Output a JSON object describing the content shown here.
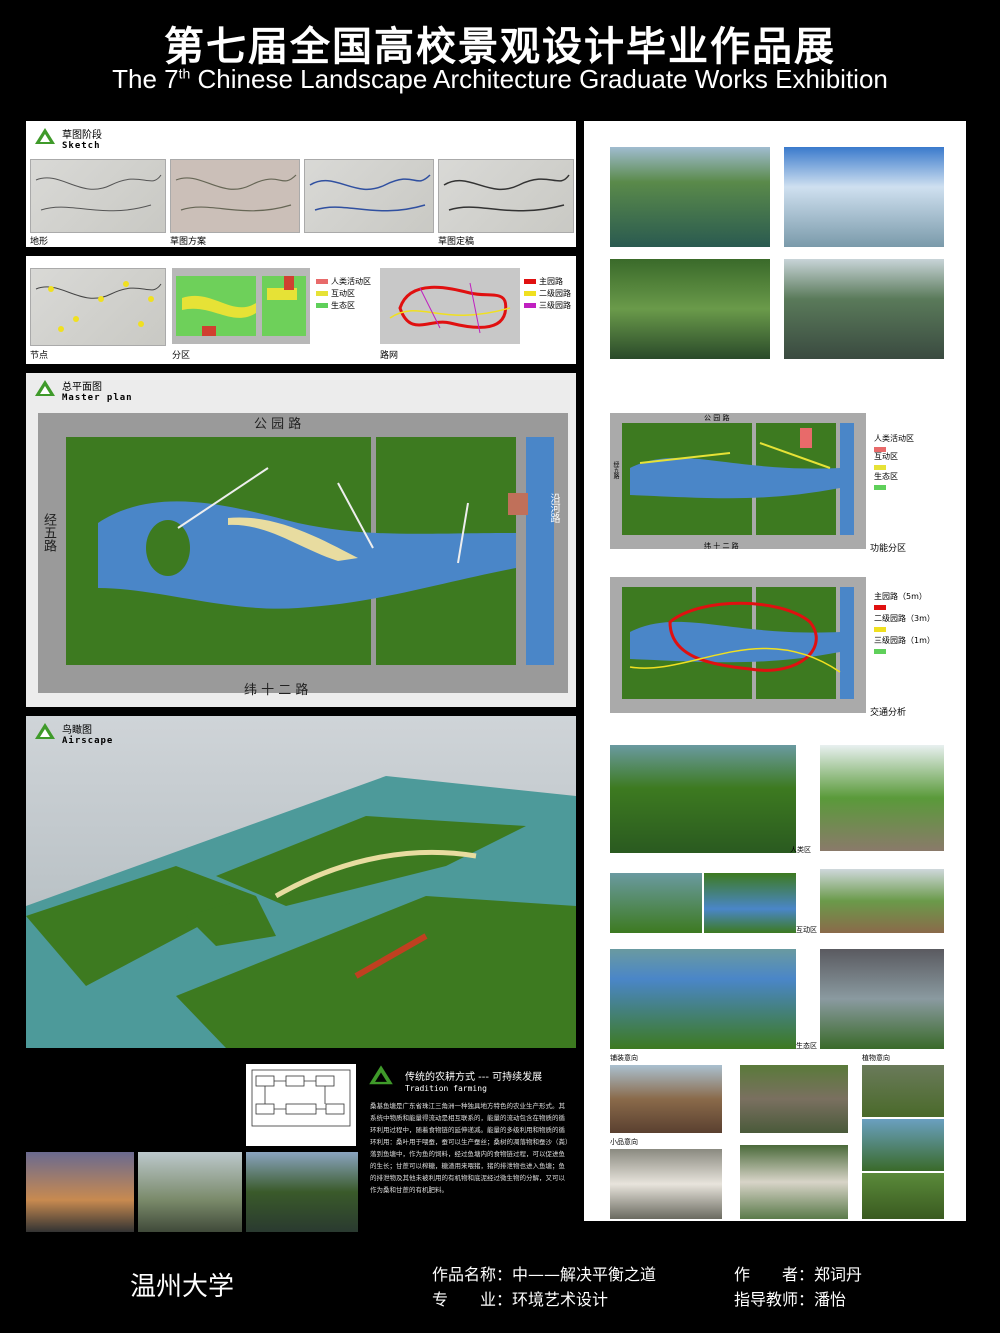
{
  "title_cn": "第七届全国高校景观设计毕业作品展",
  "title_en_pre": "The 7",
  "title_en_sup": "th",
  "title_en_post": " Chinese Landscape Architecture Graduate Works Exhibition",
  "sketch": {
    "heading_cn": "草图阶段",
    "heading_en": "Sketch",
    "captions": [
      "地形",
      "草图方案",
      "草图定稿"
    ]
  },
  "analysis": {
    "captions": [
      "节点",
      "分区",
      "路网"
    ],
    "zone_legend": [
      "人类活动区",
      "互动区",
      "生态区"
    ],
    "road_legend": [
      "主园路",
      "二级园路",
      "三级园路"
    ]
  },
  "master_plan": {
    "heading_cn": "总平面图",
    "heading_en": "Master plan",
    "road_top": "公 园 路",
    "road_bottom": "纬 十 二 路",
    "road_left": "经五路",
    "road_right": "沿河路"
  },
  "airscape": {
    "heading_cn": "鸟瞰图",
    "heading_en": "Airscape"
  },
  "tradition": {
    "heading_cn": "传统的农耕方式 --- 可持续发展",
    "heading_en": "Tradition farming",
    "paragraph": "桑基鱼塘是广东省珠江三角洲一种独具地方特色的农业生产形式。其系统中物质和能量得流动是相互联系的，能量的流动包含在物质的循环利用过程中，随着食物链的延伸递减。能量的多级利用和物质的循环利用：桑叶用于喂蚕，蚕可以生产蚕丝；桑树的凋落物和蚕沙（粪）落到鱼塘中，作为鱼的饲料，经过鱼塘内的食物链过程，可以促进鱼的生长；甘蔗可以榨糖，糖渣用来喂猪，猪的排泄物也进入鱼塘；鱼的排泄物及其他未被利用的有机物和底泥经过微生物的分解，又可以作为桑和甘蔗的有机肥料。"
  },
  "right_column": {
    "func_caption": "功能分区",
    "func_legend": [
      "人类活动区",
      "互动区",
      "生态区"
    ],
    "func_road_top": "公 园 路",
    "func_road_bottom": "纬 十 二 路",
    "func_road_left": "经五路",
    "traffic_caption": "交通分析",
    "traffic_legend": [
      "主园路（5m）",
      "二级园路（3m）",
      "三级园路（1m）"
    ],
    "human_zone": "人类区",
    "interactive_zone": "互动区",
    "eco_zone": "生态区",
    "paving": "铺装意向",
    "plants": "植物意向",
    "small_items": "小品意向"
  },
  "footer": {
    "school": "温州大学",
    "work_name_label": "作品名称：",
    "work_name": "中——解决平衡之道",
    "author_label": "作　　者：",
    "author": "郑词丹",
    "major_label": "专　　业：",
    "major": "环境艺术设计",
    "advisor_label": "指导教师：",
    "advisor": "潘怡"
  },
  "colors": {
    "background": "#000000",
    "water": "#4a86c8",
    "green": "#3f7a22",
    "human_zone": "#e86a6a",
    "interactive_zone": "#e6e236",
    "eco_zone": "#5fd05a",
    "main_road": "#e01010",
    "secondary_road": "#f0e020",
    "tertiary_road": "#c020c0"
  }
}
